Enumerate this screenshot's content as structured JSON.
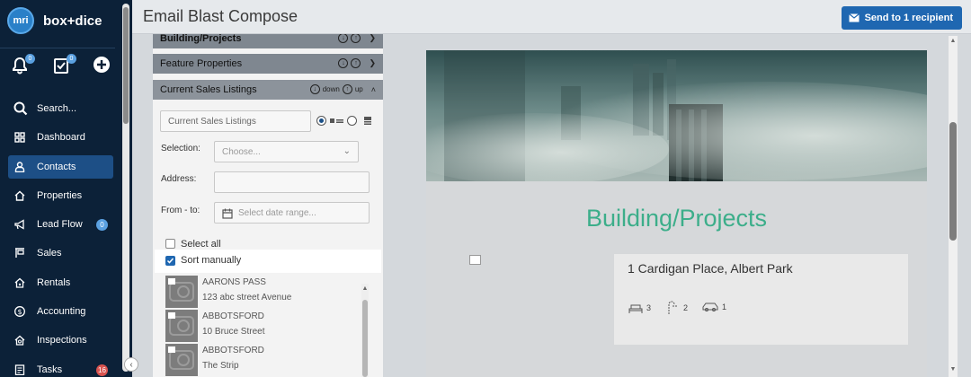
{
  "brand": {
    "logo_text": "mri",
    "name": "box+dice"
  },
  "quick_actions": [
    {
      "icon": "bell-icon",
      "badge": "0"
    },
    {
      "icon": "tasks-icon",
      "badge": "0"
    },
    {
      "icon": "plus-circle-icon"
    }
  ],
  "nav": [
    {
      "label": "Search...",
      "icon": "search-icon"
    },
    {
      "label": "Dashboard",
      "icon": "grid-icon"
    },
    {
      "label": "Contacts",
      "icon": "person-icon",
      "active": true
    },
    {
      "label": "Properties",
      "icon": "house-icon"
    },
    {
      "label": "Lead Flow",
      "icon": "megaphone-icon",
      "badge": "0",
      "badge_color": "#5aa0e0"
    },
    {
      "label": "Sales",
      "icon": "sign-icon"
    },
    {
      "label": "Rentals",
      "icon": "key-house-icon"
    },
    {
      "label": "Accounting",
      "icon": "dollar-icon"
    },
    {
      "label": "Inspections",
      "icon": "inspect-house-icon"
    },
    {
      "label": "Tasks",
      "icon": "checklist-icon",
      "badge": "16",
      "badge_color": "#d9534f"
    }
  ],
  "header": {
    "title": "Email Blast Compose",
    "send_label": "Send to 1 recipient"
  },
  "accordion": {
    "sections": [
      {
        "label": "Building/Projects"
      },
      {
        "label": "Feature Properties"
      },
      {
        "label": "Current Sales Listings",
        "down": "down",
        "up": "up"
      }
    ],
    "title_input": "Current Sales Listings",
    "selection_label": "Selection:",
    "selection_placeholder": "Choose...",
    "address_label": "Address:",
    "from_to_label": "From - to:",
    "date_placeholder": "Select date range...",
    "select_all": "Select all",
    "sort_manually": "Sort manually",
    "listings": [
      {
        "name": "AARONS PASS",
        "address": "123 abc street Avenue"
      },
      {
        "name": "ABBOTSFORD",
        "address": "10 Bruce Street"
      },
      {
        "name": "ABBOTSFORD",
        "address": "The Strip"
      }
    ]
  },
  "preview": {
    "heading": "Building/Projects",
    "property_address": "1 Cardigan Place, Albert Park",
    "bedrooms": "3",
    "bathrooms": "2",
    "car_spaces": "1"
  },
  "colors": {
    "sidebar": "#0c2138",
    "accent": "#1f67b1",
    "heading_green": "#3cae8a"
  }
}
